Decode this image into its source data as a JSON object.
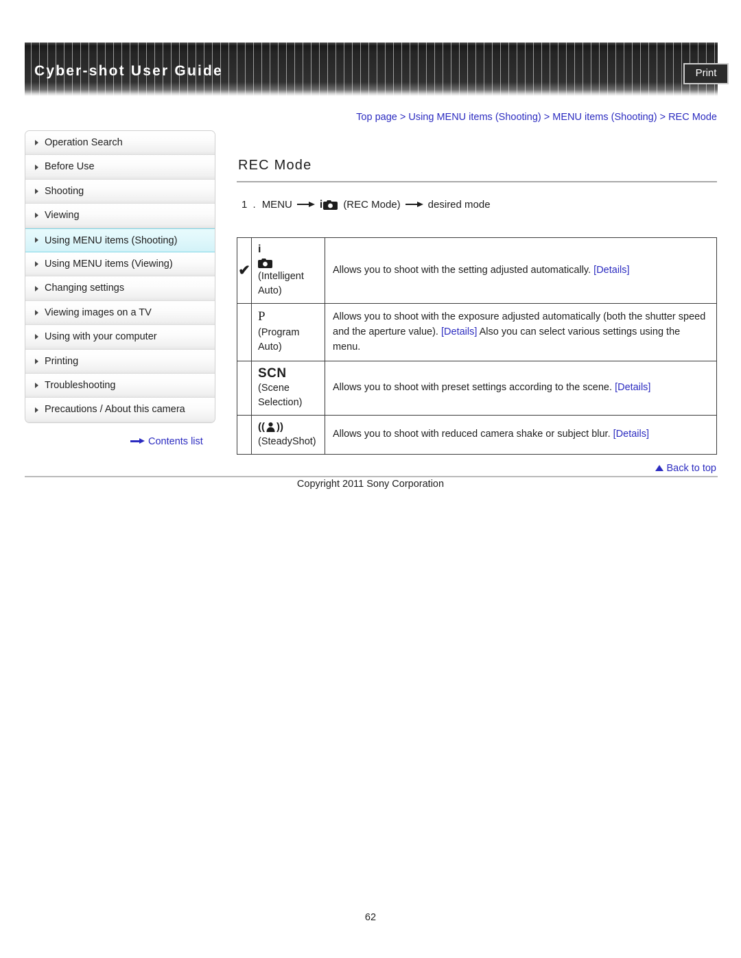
{
  "header": {
    "title": "Cyber-shot User Guide",
    "print_label": "Print"
  },
  "breadcrumb": {
    "text": "Top page > Using MENU items (Shooting) > MENU items (Shooting) > REC Mode"
  },
  "sidebar": {
    "items": [
      {
        "label": "Operation Search",
        "active": false
      },
      {
        "label": "Before Use",
        "active": false
      },
      {
        "label": "Shooting",
        "active": false
      },
      {
        "label": "Viewing",
        "active": false
      },
      {
        "label": "Using MENU items (Shooting)",
        "active": true
      },
      {
        "label": "Using MENU items (Viewing)",
        "active": false
      },
      {
        "label": "Changing settings",
        "active": false
      },
      {
        "label": "Viewing images on a TV",
        "active": false
      },
      {
        "label": "Using with your computer",
        "active": false
      },
      {
        "label": "Printing",
        "active": false
      },
      {
        "label": "Troubleshooting",
        "active": false
      },
      {
        "label": "Precautions / About this camera",
        "active": false
      }
    ],
    "contents_list_label": "Contents list"
  },
  "main": {
    "title": "REC Mode",
    "step": {
      "number": "1 .",
      "menu_label": "MENU",
      "icon_name": "intelligent-auto-icon",
      "icon_caption": "(REC Mode)",
      "target": "desired mode"
    },
    "table": {
      "rows": [
        {
          "checked": true,
          "check_glyph": "✔",
          "symbol_type": "icam",
          "symbol_text": "i",
          "mode_label": "(Intelligent Auto)",
          "desc_before": "Allows you to shoot with the setting adjusted automatically.",
          "link1": "[Details]",
          "desc_after": ""
        },
        {
          "checked": false,
          "check_glyph": "",
          "symbol_type": "p",
          "symbol_text": "P",
          "mode_label": "(Program Auto)",
          "desc_before": "Allows you to shoot with the exposure adjusted automatically (both the shutter speed and the aperture value).",
          "link1": "[Details]",
          "desc_after": "Also you can select various settings using the menu."
        },
        {
          "checked": false,
          "check_glyph": "",
          "symbol_type": "scn",
          "symbol_text": "SCN",
          "mode_label": "(Scene Selection)",
          "desc_before": "Allows you to shoot with preset settings according to the scene.",
          "link1": "[Details]",
          "desc_after": ""
        },
        {
          "checked": false,
          "check_glyph": "",
          "symbol_type": "steadyshot",
          "symbol_text": "",
          "mode_label": "(SteadyShot)",
          "desc_before": "Allows you to shoot with reduced camera shake or subject blur.",
          "link1": "[Details]",
          "desc_after": ""
        }
      ]
    }
  },
  "footer": {
    "back_to_top_label": "Back to top",
    "copyright": "Copyright 2011 Sony Corporation",
    "page_number": "62"
  },
  "colors": {
    "link": "#2b2bc0",
    "active_nav_bg": "#dff7fb",
    "active_nav_border": "#7fd6e6",
    "header_dark": "#252525"
  }
}
